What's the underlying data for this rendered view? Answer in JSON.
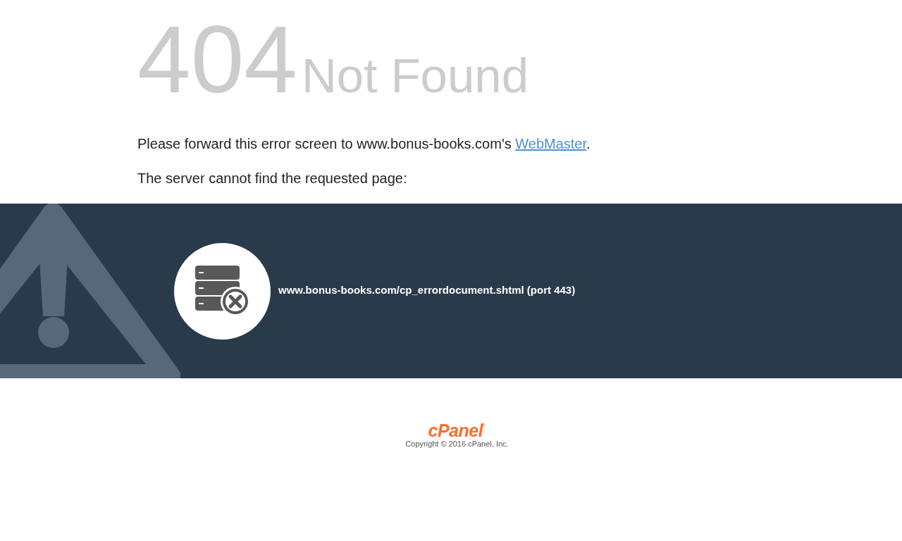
{
  "heading": {
    "code": "404",
    "title": "Not Found"
  },
  "message": {
    "text": "Please forward this error screen to www.bonus-books.com's ",
    "link": "WebMaster",
    "tail": "."
  },
  "detail": "The server cannot find the requested page:",
  "banner": {
    "url": "www.bonus-books.com/cp_errordocument.shtml (port 443)"
  },
  "footer": {
    "logo": "cPanel",
    "registered": "®",
    "copyright": "Copyright © 2016 cPanel, Inc."
  }
}
